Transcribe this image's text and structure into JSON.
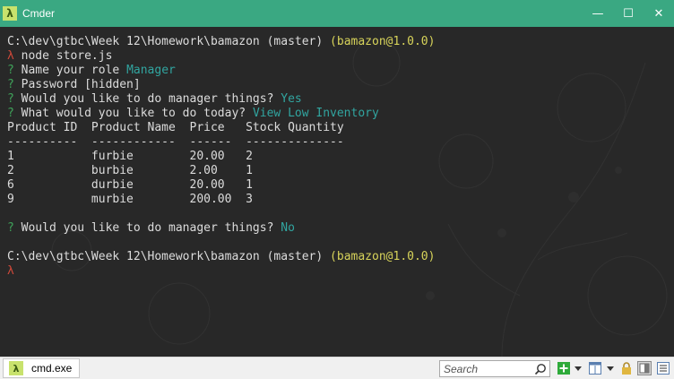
{
  "window": {
    "title": "Cmder",
    "icon_glyph": "λ",
    "minimize_glyph": "—",
    "maximize_glyph": "☐",
    "close_glyph": "✕"
  },
  "console": {
    "lines": [
      {
        "segments": [
          {
            "text": "C:\\dev\\gtbc\\Week 12\\Homework\\bamazon ",
            "color": "white"
          },
          {
            "text": "(master) ",
            "color": "white"
          },
          {
            "text": "(bamazon@1.0.0)",
            "color": "yellow"
          }
        ]
      },
      {
        "segments": [
          {
            "text": "λ ",
            "color": "red"
          },
          {
            "text": "node store.js",
            "color": "white"
          }
        ]
      },
      {
        "segments": [
          {
            "text": "? ",
            "color": "green"
          },
          {
            "text": "Name your role ",
            "color": "white"
          },
          {
            "text": "Manager",
            "color": "cyan"
          }
        ]
      },
      {
        "segments": [
          {
            "text": "? ",
            "color": "green"
          },
          {
            "text": "Password [hidden]",
            "color": "white"
          }
        ]
      },
      {
        "segments": [
          {
            "text": "? ",
            "color": "green"
          },
          {
            "text": "Would you like to do manager things? ",
            "color": "white"
          },
          {
            "text": "Yes",
            "color": "cyan"
          }
        ]
      },
      {
        "segments": [
          {
            "text": "? ",
            "color": "green"
          },
          {
            "text": "What would you like to do today? ",
            "color": "white"
          },
          {
            "text": "View Low Inventory",
            "color": "cyan"
          }
        ]
      },
      {
        "segments": [
          {
            "text": "Product ID  Product Name  Price   Stock Quantity",
            "color": "white"
          }
        ]
      },
      {
        "segments": [
          {
            "text": "----------  ------------  ------  --------------",
            "color": "white"
          }
        ]
      },
      {
        "segments": [
          {
            "text": "1           furbie        20.00   2",
            "color": "white"
          }
        ]
      },
      {
        "segments": [
          {
            "text": "2           burbie        2.00    1",
            "color": "white"
          }
        ]
      },
      {
        "segments": [
          {
            "text": "6           durbie        20.00   1",
            "color": "white"
          }
        ]
      },
      {
        "segments": [
          {
            "text": "9           murbie        200.00  3",
            "color": "white"
          }
        ]
      },
      {
        "segments": [
          {
            "text": "",
            "color": "white"
          }
        ]
      },
      {
        "segments": [
          {
            "text": "? ",
            "color": "green"
          },
          {
            "text": "Would you like to do manager things? ",
            "color": "white"
          },
          {
            "text": "No",
            "color": "cyan"
          }
        ]
      },
      {
        "segments": [
          {
            "text": "",
            "color": "white"
          }
        ]
      },
      {
        "segments": [
          {
            "text": "C:\\dev\\gtbc\\Week 12\\Homework\\bamazon ",
            "color": "white"
          },
          {
            "text": "(master) ",
            "color": "white"
          },
          {
            "text": "(bamazon@1.0.0)",
            "color": "yellow"
          }
        ]
      },
      {
        "segments": [
          {
            "text": "λ",
            "color": "red"
          }
        ]
      }
    ]
  },
  "statusbar": {
    "tab_icon_glyph": "λ",
    "tab_label": "cmd.exe",
    "search_placeholder": "Search",
    "buttons": [
      "add-tab-icon",
      "dropdown-icon",
      "split-view-icon",
      "dropdown-icon",
      "lock-icon",
      "layout-icon",
      "menu-icon"
    ]
  },
  "colors": {
    "titlebar": "#3aa882",
    "console_bg": "#282828",
    "prompt_yellow": "#d7d35a",
    "lambda_red": "#d0493a",
    "question_green": "#3fa25a",
    "answer_cyan": "#31a5a0"
  }
}
